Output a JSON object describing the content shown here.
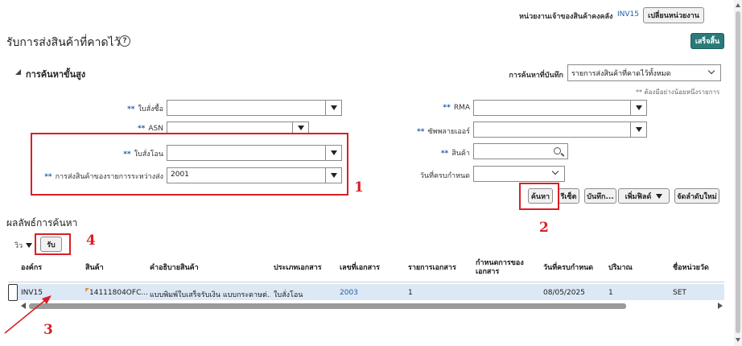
{
  "header": {
    "org_label": "หน่วยงานเจ้าของสินค้าคงคลัง",
    "org_value": "INV15",
    "change_org_button": "เปลี่ยนหน่วยงาน"
  },
  "page": {
    "title": "รับการส่งสินค้าที่คาดไว้",
    "help_icon_glyph": "?",
    "finish_button": "เสร็จสิ้น"
  },
  "search": {
    "section_title": "การค้นหาขั้นสูง",
    "saved_search_label": "การค้นหาที่บันทึก",
    "saved_search_value": "รายการส่งสินค้าที่คาดไว้ทั้งหมด",
    "at_least_one_note": "** ต้องมีอย่างน้อยหนึ่งรายการ",
    "required_mark": "**",
    "fields": {
      "purchase_order": {
        "label": "ใบสั่งซื้อ",
        "value": ""
      },
      "asn": {
        "label": "ASN",
        "value": ""
      },
      "transfer_order": {
        "label": "ใบสั่งโอน",
        "value": ""
      },
      "in_transit_shipment": {
        "label": "การส่งสินค้าของรายการระหว่างส่ง",
        "value": "2001"
      },
      "rma": {
        "label": "RMA",
        "value": ""
      },
      "supplier": {
        "label": "ซัพพลายเออร์",
        "value": ""
      },
      "item": {
        "label": "สินค้า",
        "value": ""
      },
      "due_date": {
        "label": "วันที่ครบกำหนด",
        "value": ""
      }
    },
    "buttons": {
      "search": "ค้นหา",
      "reset": "รีเซ็ต",
      "save": "บันทึก...",
      "add_fields": "เพิ่มฟิลด์",
      "reorder": "จัดลำดับใหม่"
    }
  },
  "results": {
    "title": "ผลลัพธ์การค้นหา",
    "view_menu": "วิว",
    "receive_button": "รับ",
    "columns": [
      "องค์กร",
      "สินค้า",
      "คำอธิบายสินค้า",
      "ประเภทเอกสาร",
      "เลขที่เอกสาร",
      "รายการเอกสาร",
      "กำหนดการของเอกสาร",
      "วันที่ครบกำหนด",
      "ปริมาณ",
      "ชื่อหน่วยวัด"
    ],
    "rows": [
      {
        "org": "INV15",
        "item": "14111804OFC...",
        "description": "แบบพิมพ์ใบเสร็จรับเงิน แบบกระดาษต่...",
        "doc_type": "ใบสั่งโอน",
        "doc_number": "2003",
        "doc_line": "1",
        "doc_schedule": "",
        "due_date": "08/05/2025",
        "quantity": "1",
        "uom": "SET"
      }
    ]
  },
  "annotations": {
    "num1": "1",
    "num2": "2",
    "num3": "3",
    "num4": "4"
  },
  "colors": {
    "primary_button": "#2a7a7a",
    "link": "#1f5fa8",
    "annotation_red": "#d91f26",
    "selected_row": "#dce8f5"
  }
}
